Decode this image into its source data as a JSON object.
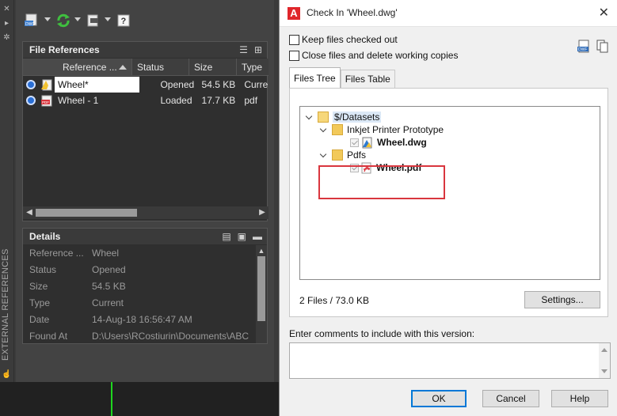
{
  "left_palette": {
    "vertical_title": "EXTERNAL REFERENCES",
    "file_references": {
      "title": "File References",
      "columns": [
        "Reference ...",
        "Status",
        "Size",
        "Type"
      ],
      "rows": [
        {
          "name": "Wheel*",
          "status": "Opened",
          "size": "54.5 KB",
          "type": "Curre"
        },
        {
          "name": "Wheel - 1",
          "status": "Loaded",
          "size": "17.7 KB",
          "type": "pdf"
        }
      ]
    },
    "details": {
      "title": "Details",
      "rows": [
        {
          "label": "Reference ...",
          "value": "Wheel"
        },
        {
          "label": "Status",
          "value": "Opened"
        },
        {
          "label": "Size",
          "value": "54.5 KB"
        },
        {
          "label": "Type",
          "value": "Current"
        },
        {
          "label": "Date",
          "value": "14-Aug-18 16:56:47 AM"
        },
        {
          "label": "Found At",
          "value": "D:\\Users\\RCostiurin\\Documents\\ABC"
        }
      ]
    }
  },
  "dialog": {
    "logo_letter": "A",
    "title": "Check In 'Wheel.dwg'",
    "keep_checked_out": "Keep files checked out",
    "close_and_delete": "Close files and delete working copies",
    "tabs": [
      "Files Tree",
      "Files Table"
    ],
    "tree": {
      "root": "$/Datasets",
      "folder1": "Inkjet Printer Prototype",
      "file1": "Wheel.dwg",
      "folder2": "Pdfs",
      "file2": "Wheel.pdf"
    },
    "summary": "2 Files / 73.0 KB",
    "settings_button": "Settings...",
    "comments_label": "Enter comments to include with this version:",
    "comments_value": "",
    "ok_button": "OK",
    "cancel_button": "Cancel",
    "help_button": "Help"
  }
}
